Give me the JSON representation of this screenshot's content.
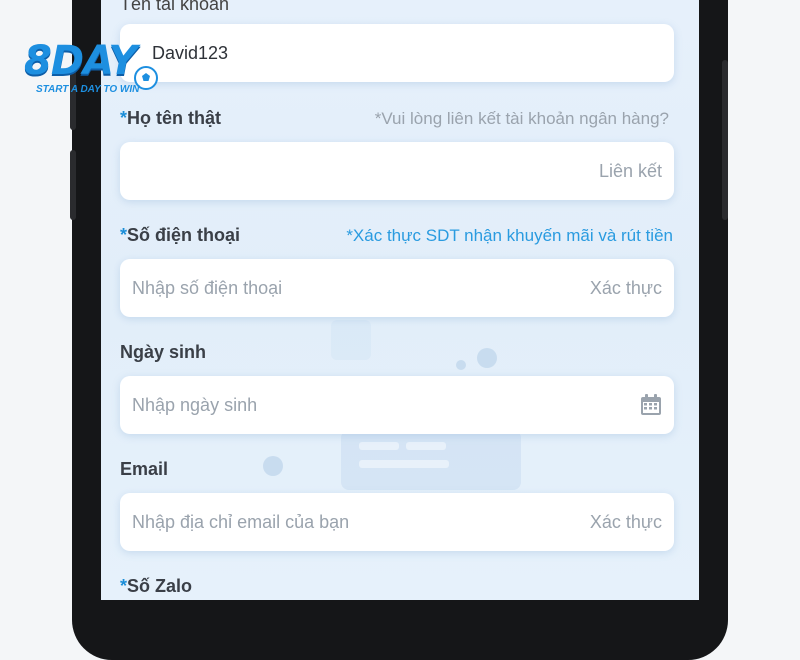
{
  "brand": {
    "logo_text": "8DAY",
    "tagline": "START A DAY TO WIN"
  },
  "form": {
    "username": {
      "label": "Tên tài khoản",
      "value": "David123"
    },
    "fullname": {
      "star": "*",
      "label": "Họ tên thật",
      "hint": "*Vui lòng liên kết tài khoản ngân hàng?",
      "action": "Liên kết"
    },
    "phone": {
      "star": "*",
      "label": "Số điện thoại",
      "hint": "*Xác thực SDT nhận khuyến mãi và rút tiền",
      "placeholder": "Nhập số điện thoại",
      "action": "Xác thực"
    },
    "birthday": {
      "label": "Ngày sinh",
      "placeholder": "Nhập ngày sinh",
      "icon": "calendar-icon"
    },
    "email": {
      "label": "Email",
      "placeholder": "Nhập địa chỉ email của bạn",
      "action": "Xác thực"
    },
    "zalo": {
      "star": "*",
      "label": "Số Zalo"
    }
  },
  "colors": {
    "accent": "#2a9be0",
    "star": "#1c8ed8",
    "background": "#e4eff9"
  }
}
